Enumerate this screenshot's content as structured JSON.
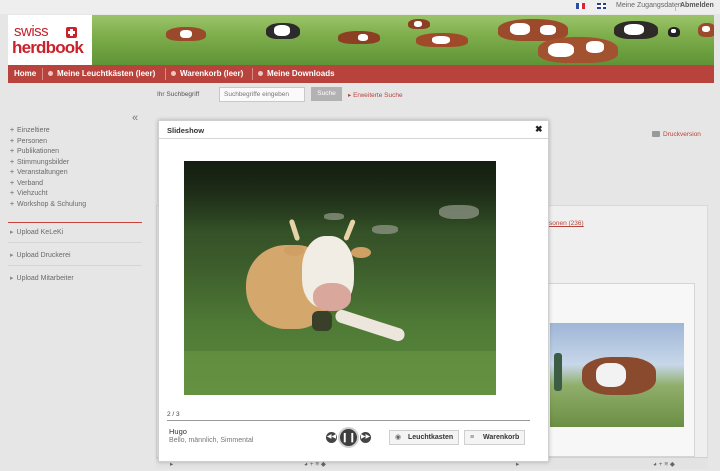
{
  "topbar": {
    "flags": [
      "flag-fr-icon",
      "flag-uk-icon"
    ],
    "account_label": "Meine Zugangsdaten",
    "logout_label": "Abmelden"
  },
  "logo": {
    "line1": "swiss",
    "line2": "herdbook"
  },
  "nav": {
    "home": "Home",
    "lightboxes": "Meine Leuchtkästen (leer)",
    "cart": "Warenkorb (leer)",
    "downloads": "Meine Downloads"
  },
  "search": {
    "label": "Ihr Suchbegriff",
    "placeholder": "Suchbegriffe eingeben",
    "button": "Suche",
    "advanced": "Erweiterte Suche"
  },
  "sidebar": {
    "items": [
      "Einzeltiere",
      "Personen",
      "Publikationen",
      "Stimmungsbilder",
      "Veranstaltungen",
      "Verband",
      "Viehzucht",
      "Workshop & Schulung"
    ],
    "uploads": [
      "Upload KeLeKi",
      "Upload Druckerei",
      "Upload Mitarbeiter"
    ]
  },
  "background": {
    "print_link": "Druckversion",
    "partial_link": "sonen (236)"
  },
  "modal": {
    "title": "Slideshow",
    "counter": "2 / 3",
    "cow_name": "Hugo",
    "cow_desc": "Bello, männlich, Simmental",
    "btn_lightbox": "Leuchtkasten",
    "btn_cart": "Warenkorb"
  },
  "colors": {
    "brand_red": "#b8433c",
    "logo_red": "#c8232c"
  }
}
